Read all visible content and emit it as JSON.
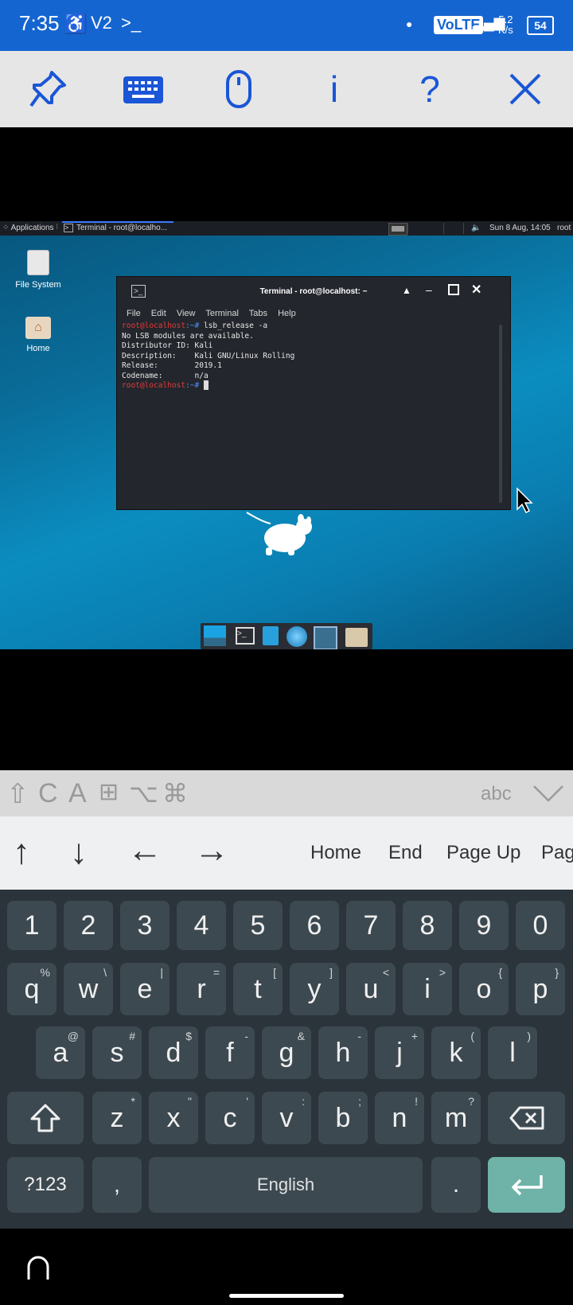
{
  "status_bar": {
    "time": "7:35",
    "volte": "VoLTE",
    "speed_value": "5.2",
    "speed_unit": "K/s",
    "battery": "54"
  },
  "toolbar": {
    "buttons": [
      {
        "name": "pin-icon",
        "glyph": "📌"
      },
      {
        "name": "keyboard-icon",
        "glyph": "⌨"
      },
      {
        "name": "mouse-icon",
        "glyph": "🖱"
      },
      {
        "name": "info-icon",
        "glyph": "i"
      },
      {
        "name": "help-icon",
        "glyph": "?"
      },
      {
        "name": "close-icon",
        "glyph": "✕"
      }
    ]
  },
  "remote": {
    "panel": {
      "applications": "Applications",
      "task": "Terminal - root@localho...",
      "clock": "Sun 8 Aug, 14:05",
      "user": "root"
    },
    "desktop_icons": [
      {
        "label": "File System"
      },
      {
        "label": "Home"
      }
    ],
    "terminal": {
      "title": "Terminal - root@localhost: ~",
      "menu": [
        "File",
        "Edit",
        "View",
        "Terminal",
        "Tabs",
        "Help"
      ],
      "prompt_user": "root@localhost",
      "prompt_path": ":~#",
      "command": " lsb_release -a",
      "output": [
        "No LSB modules are available.",
        "Distributor ID: Kali",
        "Description:    Kali GNU/Linux Rolling",
        "Release:        2019.1",
        "Codename:       n/a"
      ]
    }
  },
  "modifiers": {
    "keys": [
      "⇧",
      "C",
      "A",
      "⊞",
      "⌥",
      "⌘"
    ],
    "abc": "abc"
  },
  "special_keys": {
    "arrows": [
      "↑",
      "↓",
      "←",
      "→"
    ],
    "words": [
      "Home",
      "End",
      "Page Up",
      "Page Down"
    ]
  },
  "keyboard": {
    "numbers": [
      "1",
      "2",
      "3",
      "4",
      "5",
      "6",
      "7",
      "8",
      "9",
      "0"
    ],
    "row1": [
      {
        "k": "q",
        "s": "%"
      },
      {
        "k": "w",
        "s": "\\"
      },
      {
        "k": "e",
        "s": "|"
      },
      {
        "k": "r",
        "s": "="
      },
      {
        "k": "t",
        "s": "["
      },
      {
        "k": "y",
        "s": "]"
      },
      {
        "k": "u",
        "s": "<"
      },
      {
        "k": "i",
        "s": ">"
      },
      {
        "k": "o",
        "s": "{"
      },
      {
        "k": "p",
        "s": "}"
      }
    ],
    "row2": [
      {
        "k": "a",
        "s": "@"
      },
      {
        "k": "s",
        "s": "#"
      },
      {
        "k": "d",
        "s": "$"
      },
      {
        "k": "f",
        "s": "-"
      },
      {
        "k": "g",
        "s": "&"
      },
      {
        "k": "h",
        "s": "-"
      },
      {
        "k": "j",
        "s": "+"
      },
      {
        "k": "k",
        "s": "("
      },
      {
        "k": "l",
        "s": ")"
      }
    ],
    "row3": [
      {
        "k": "z",
        "s": "*"
      },
      {
        "k": "x",
        "s": "\""
      },
      {
        "k": "c",
        "s": "'"
      },
      {
        "k": "v",
        "s": ":"
      },
      {
        "k": "b",
        "s": ";"
      },
      {
        "k": "n",
        "s": "!"
      },
      {
        "k": "m",
        "s": "?"
      }
    ],
    "symbols": "?123",
    "comma": ",",
    "space": "English",
    "period": "."
  },
  "colors": {
    "status_blue": "#1565d0",
    "toolbar_icon_blue": "#1a56d6",
    "enter_key": "#6fb3a8"
  }
}
